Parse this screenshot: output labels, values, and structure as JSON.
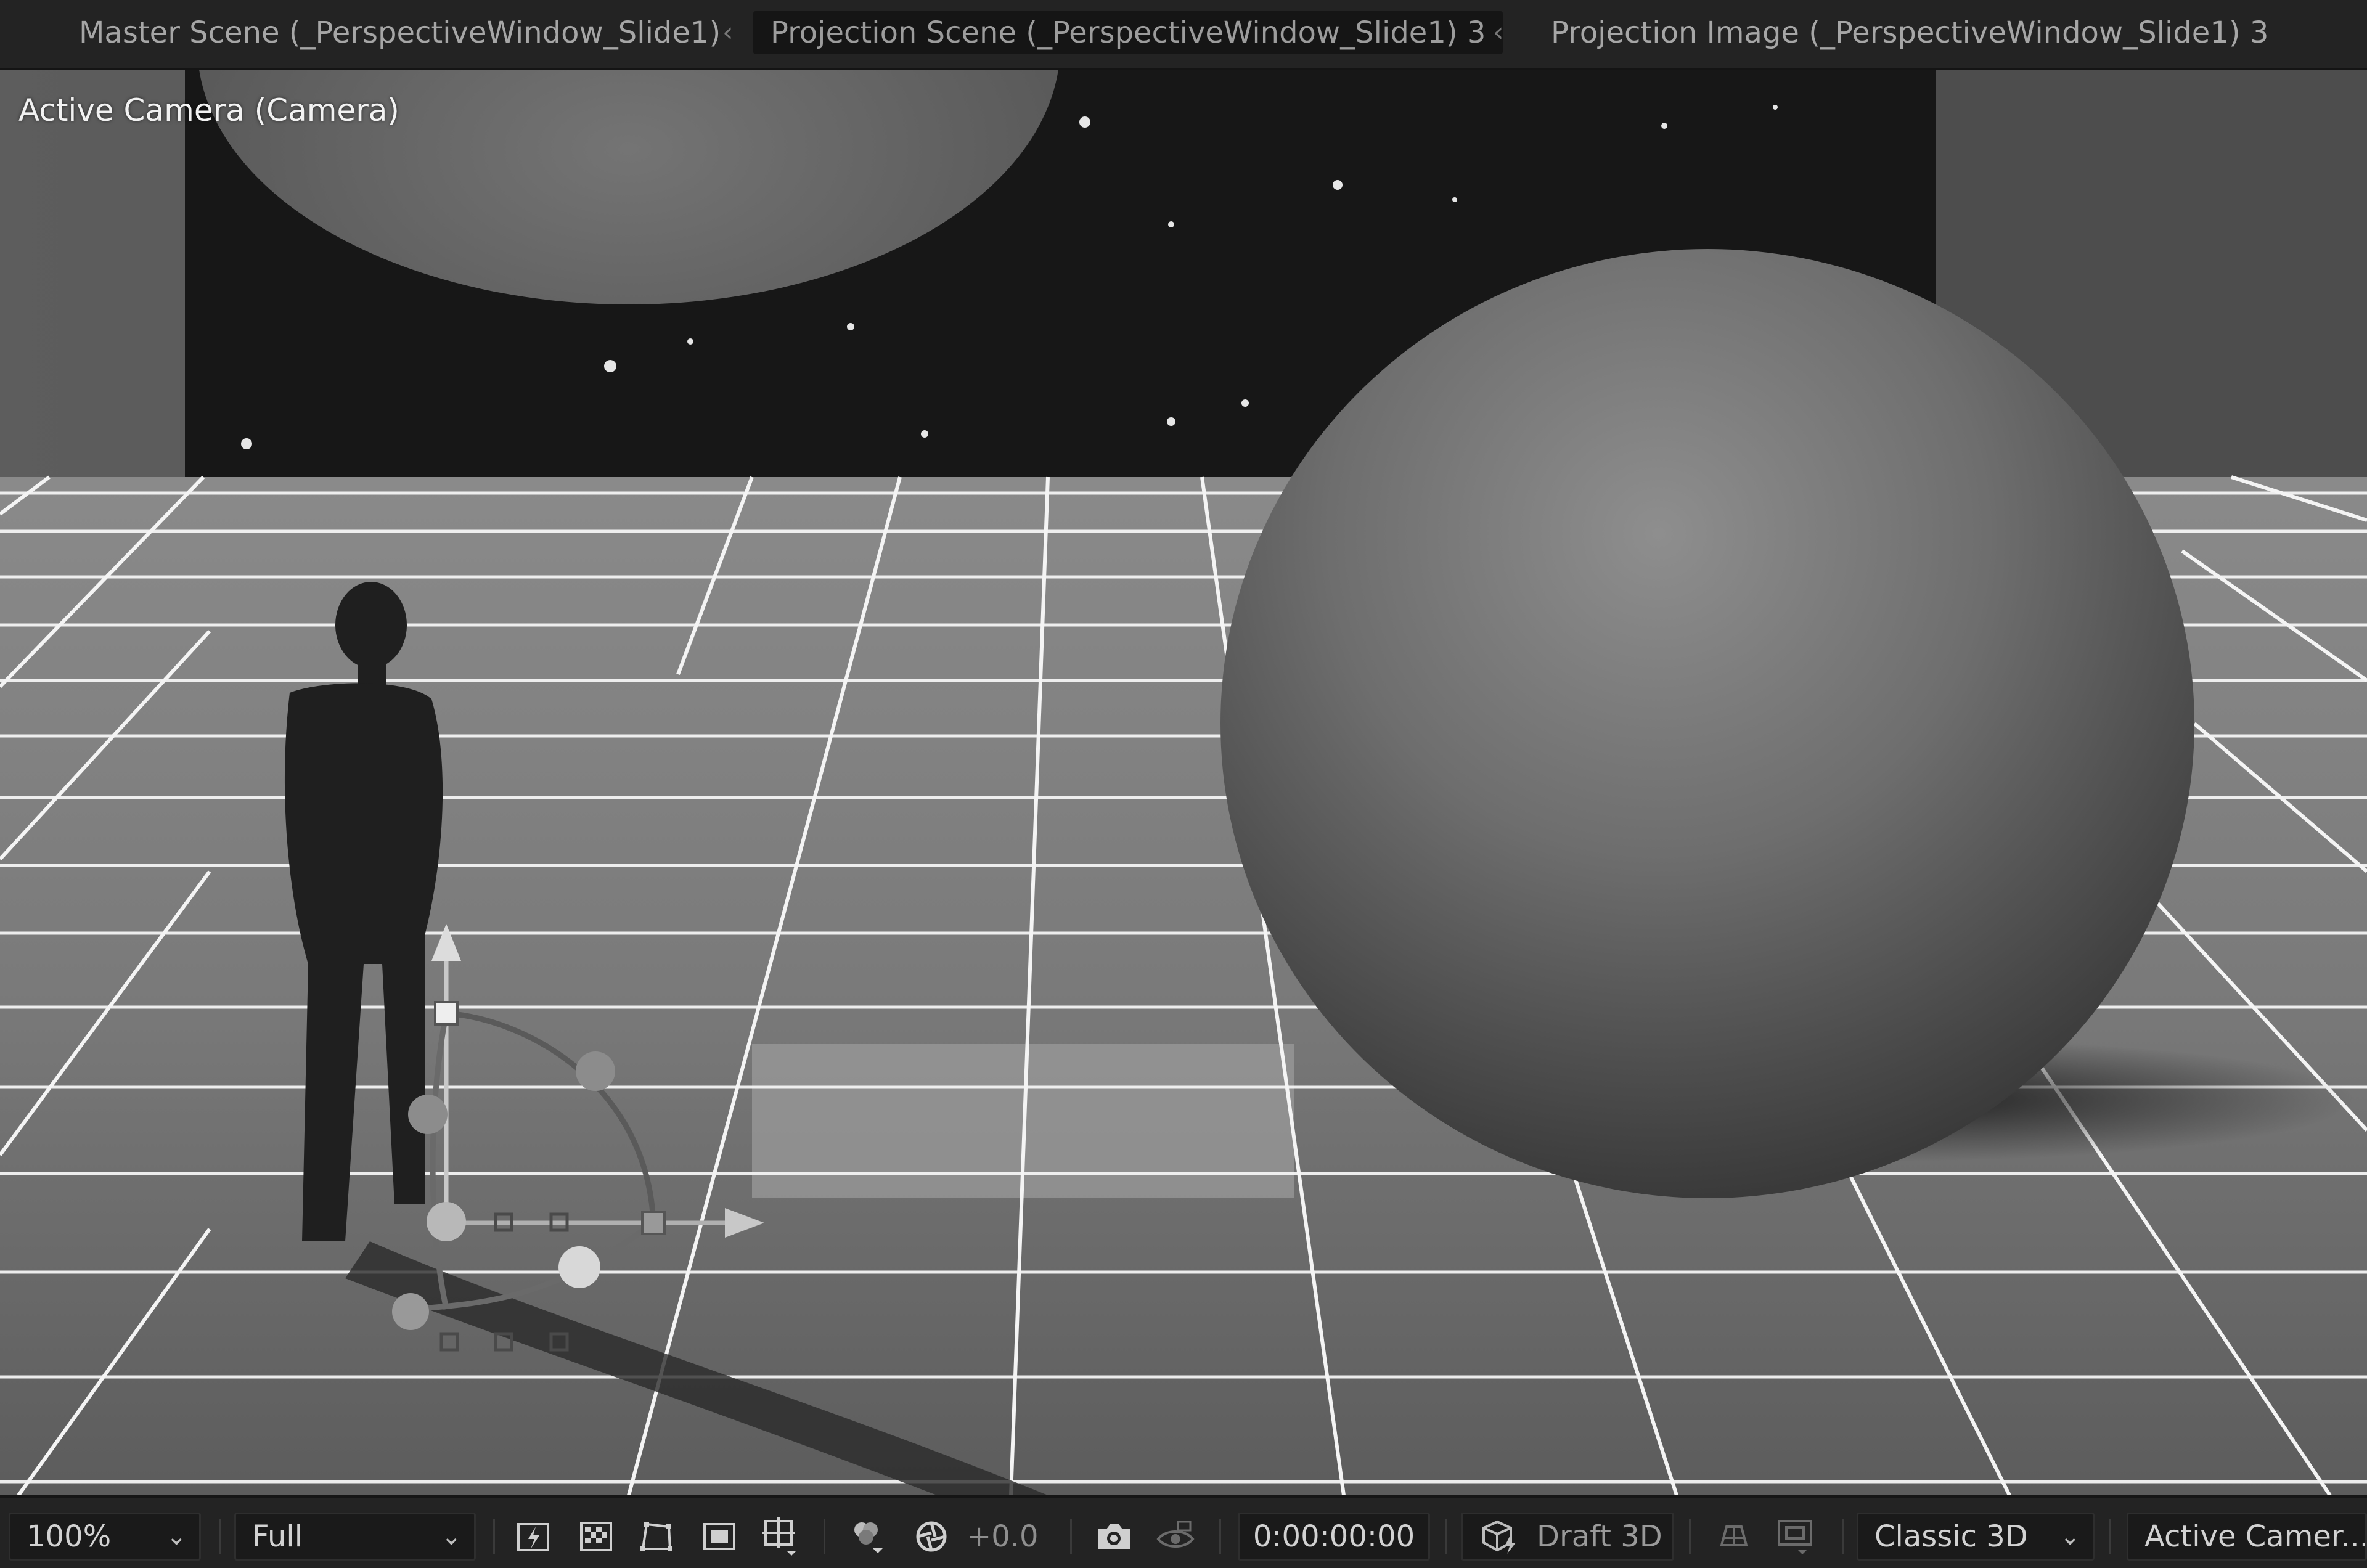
{
  "breadcrumbs": {
    "items": [
      {
        "label": "Master Scene (_PerspectiveWindow_Slide1)"
      },
      {
        "label": "Projection Scene (_PerspectiveWindow_Slide1) 3"
      },
      {
        "label": "Projection Image (_PerspectiveWindow_Slide1) 3"
      }
    ],
    "separator": "‹",
    "active_index": 1
  },
  "viewer": {
    "label": "Active Camera (Camera)"
  },
  "toolbar": {
    "magnification": "100%",
    "resolution": "Full",
    "exposure": "+0.0",
    "timecode": "0:00:00:00",
    "draft_3d": "Draft 3D",
    "renderer": "Classic 3D",
    "view": "Active Camer..."
  },
  "colors": {
    "panel_bg": "#232323",
    "viewer_grid": "#f4f4f4",
    "label_text": "#f2f2f2"
  }
}
